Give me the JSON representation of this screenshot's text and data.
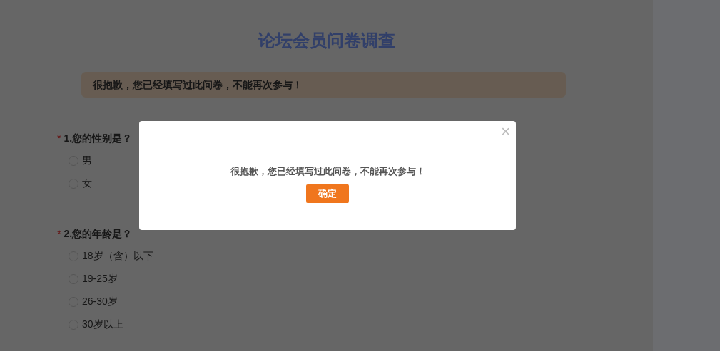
{
  "survey": {
    "title": "论坛会员问卷调查",
    "notice": "很抱歉，您已经填写过此问卷，不能再次参与！",
    "questions": [
      {
        "label": "1.您的性别是？",
        "required_mark": "*",
        "options": [
          {
            "label": "男",
            "selected": false
          },
          {
            "label": "女",
            "selected": false
          }
        ]
      },
      {
        "label": "2.您的年龄是？",
        "required_mark": "*",
        "options": [
          {
            "label": "18岁（含）以下",
            "selected": false
          },
          {
            "label": "19-25岁",
            "selected": false
          },
          {
            "label": "26-30岁",
            "selected": false
          },
          {
            "label": "30岁以上",
            "selected": false
          }
        ]
      }
    ]
  },
  "dialog": {
    "close": "×",
    "message": "很抱歉，您已经填写过此问卷，不能再次参与！",
    "button": "确定"
  }
}
